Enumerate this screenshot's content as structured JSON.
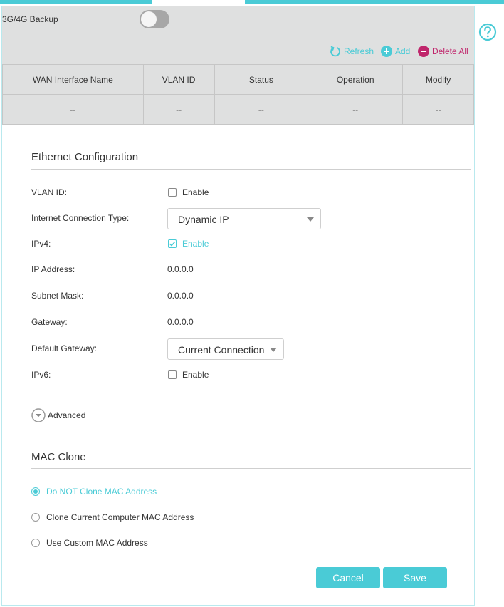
{
  "backup": {
    "label": "3G/4G Backup",
    "enabled": false
  },
  "actions": {
    "refresh": "Refresh",
    "add": "Add",
    "delete_all": "Delete All"
  },
  "table": {
    "headers": [
      "WAN Interface Name",
      "VLAN ID",
      "Status",
      "Operation",
      "Modify"
    ],
    "rows": [
      [
        "--",
        "--",
        "--",
        "--",
        "--"
      ]
    ]
  },
  "ethernet": {
    "title": "Ethernet Configuration",
    "vlan_id": {
      "label": "VLAN ID:",
      "option": "Enable",
      "checked": false
    },
    "connection_type": {
      "label": "Internet Connection Type:",
      "value": "Dynamic IP"
    },
    "ipv4": {
      "label": "IPv4:",
      "option": "Enable",
      "checked": true
    },
    "ip_address": {
      "label": "IP Address:",
      "value": "0.0.0.0"
    },
    "subnet_mask": {
      "label": "Subnet Mask:",
      "value": "0.0.0.0"
    },
    "gateway": {
      "label": "Gateway:",
      "value": "0.0.0.0"
    },
    "default_gateway": {
      "label": "Default Gateway:",
      "value": "Current Connection"
    },
    "ipv6": {
      "label": "IPv6:",
      "option": "Enable",
      "checked": false
    },
    "advanced": "Advanced"
  },
  "mac_clone": {
    "title": "MAC Clone",
    "options": [
      "Do NOT Clone MAC Address",
      "Clone Current Computer MAC Address",
      "Use Custom MAC Address"
    ],
    "selected": 0
  },
  "buttons": {
    "cancel": "Cancel",
    "save": "Save"
  },
  "colors": {
    "accent": "#4acbd6",
    "danger": "#c0266c",
    "panel_gray": "#dfe0e0"
  }
}
